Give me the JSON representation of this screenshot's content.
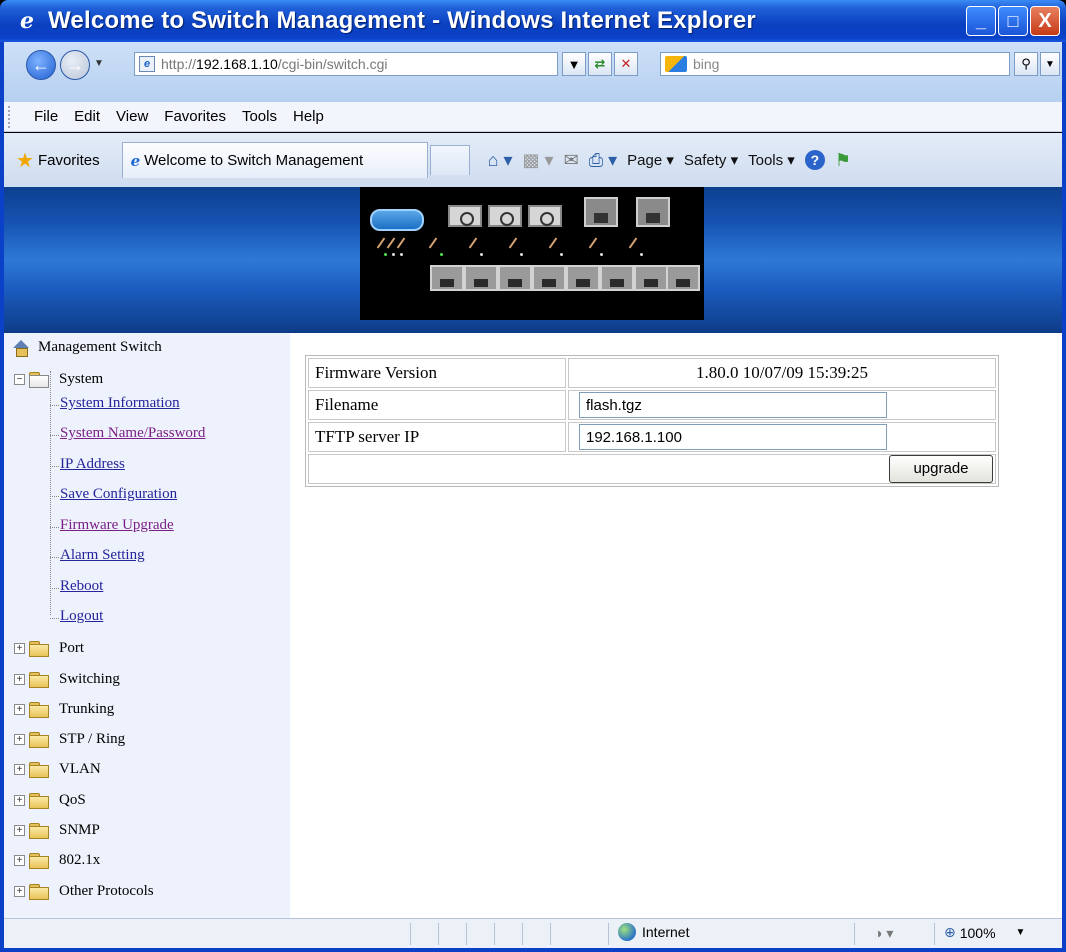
{
  "window": {
    "title": "Welcome to Switch Management - Windows Internet Explorer",
    "minimize": "_",
    "maximize": "□",
    "close": "X"
  },
  "address_bar": {
    "url_prefix": "http://",
    "url_host": "192.168.1.10",
    "url_path": "/cgi-bin/switch.cgi",
    "search_placeholder": "bing"
  },
  "menu": {
    "items": [
      "File",
      "Edit",
      "View",
      "Favorites",
      "Tools",
      "Help"
    ]
  },
  "favorites_bar": {
    "favorites_label": "Favorites",
    "tab_title": "Welcome to Switch Management",
    "commands": {
      "page": "Page",
      "safety": "Safety",
      "tools": "Tools"
    }
  },
  "sidebar": {
    "root": "Management Switch",
    "system": {
      "label": "System",
      "items": [
        {
          "label": "System Information"
        },
        {
          "label": "System Name/Password"
        },
        {
          "label": "IP Address"
        },
        {
          "label": "Save Configuration"
        },
        {
          "label": "Firmware Upgrade"
        },
        {
          "label": "Alarm Setting"
        },
        {
          "label": "Reboot"
        },
        {
          "label": "Logout"
        }
      ]
    },
    "folders": [
      {
        "label": "Port"
      },
      {
        "label": "Switching"
      },
      {
        "label": "Trunking"
      },
      {
        "label": "STP / Ring"
      },
      {
        "label": "VLAN"
      },
      {
        "label": "QoS"
      },
      {
        "label": "SNMP"
      },
      {
        "label": "802.1x"
      },
      {
        "label": "Other Protocols"
      }
    ]
  },
  "form": {
    "firmware_version_label": "Firmware Version",
    "firmware_version_value": "1.80.0 10/07/09 15:39:25",
    "filename_label": "Filename",
    "filename_value": "flash.tgz",
    "tftp_label": "TFTP server IP",
    "tftp_value": "192.168.1.100",
    "upgrade_button": "upgrade"
  },
  "status_bar": {
    "zone": "Internet",
    "zoom": "100%"
  }
}
